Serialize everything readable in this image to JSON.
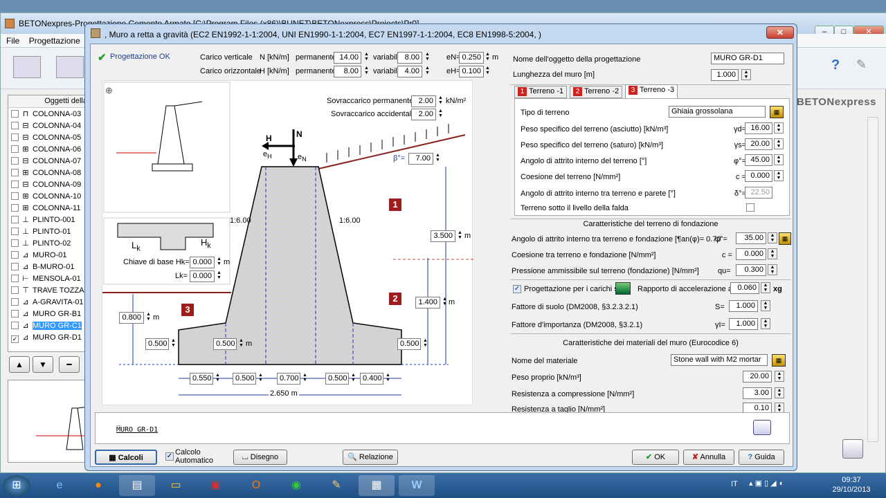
{
  "app": {
    "title": "BETONexpres-Progettazione Cemento Armato [C:\\Program Files (x86)\\BUNET\\BETONexpress\\Projects\\Pr0]",
    "menu": [
      "File",
      "Progettazione"
    ],
    "brand": "BETONexpress",
    "win_controls": [
      "–",
      "□",
      "✕"
    ]
  },
  "tree": {
    "header": "Oggetti della",
    "items": [
      {
        "label": "COLONNA-03",
        "checked": false
      },
      {
        "label": "COLONNA-04",
        "checked": false
      },
      {
        "label": "COLONNA-05",
        "checked": false
      },
      {
        "label": "COLONNA-06",
        "checked": false
      },
      {
        "label": "COLONNA-07",
        "checked": false
      },
      {
        "label": "COLONNA-08",
        "checked": false
      },
      {
        "label": "COLONNA-09",
        "checked": false
      },
      {
        "label": "COLONNA-10",
        "checked": false
      },
      {
        "label": "COLONNA-11",
        "checked": false
      },
      {
        "label": "PLINTO-001",
        "checked": false
      },
      {
        "label": "PLINTO-01",
        "checked": false
      },
      {
        "label": "PLINTO-02",
        "checked": false
      },
      {
        "label": "MURO-01",
        "checked": false
      },
      {
        "label": "B-MURO-01",
        "checked": false
      },
      {
        "label": "MENSOLA-01",
        "checked": false
      },
      {
        "label": "TRAVE TOZZA",
        "checked": false
      },
      {
        "label": "A-GRAVITA-01",
        "checked": false
      },
      {
        "label": "MURO GR-B1",
        "checked": false
      },
      {
        "label": "MURO GR-C1",
        "checked": false
      },
      {
        "label": "MURO GR-D1",
        "checked": true
      }
    ],
    "buttons": [
      "▲",
      "▼",
      "━"
    ]
  },
  "dialog": {
    "title": ", Muro a retta a gravità (EC2 EN1992-1-1:2004, UNI EN1990-1-1:2004, EC7 EN1997-1-1:2004, EC8 EN1998-5:2004, )",
    "close": "✕",
    "status": "Progettazione OK",
    "loads": {
      "vert_label": "Carico verticale",
      "vert_unit": "N [kN/m]",
      "horiz_label": "Carico orizzontale",
      "horiz_unit": "H [kN/m]",
      "perm": "permanente",
      "var": "variabile",
      "N_perm": "14.00",
      "N_var": "8.00",
      "eN_label": "eN=",
      "eN": "0.250",
      "H_perm": "8.00",
      "H_var": "4.00",
      "eH_label": "eH=",
      "eH": "0.100",
      "unit_m": "m"
    },
    "surcharge": {
      "perm_label": "Sovraccarico permanente",
      "perm": "2.00",
      "unit": "kN/m²",
      "acc_label": "Sovraccarico accidentale",
      "acc": "2.00",
      "beta_label": "β°=",
      "beta": "7.00"
    },
    "key": {
      "label_hk": "Chiave di base Hk=",
      "hk": "0.000",
      "label_lk": "Lk=",
      "lk": "0.000",
      "unit": "m",
      "Lk": "L",
      "Hk": "H",
      "sub": "k"
    },
    "drawing": {
      "H": "H",
      "N": "N",
      "eH": "e",
      "eHsub": "H",
      "eN": "e",
      "eNsub": "N",
      "slope_l": "1:6.00",
      "slope_r": "1:6.00",
      "h_total": "3.500",
      "h_lower": "1.400",
      "h_embed": "0.800",
      "base_l": "0.500",
      "base_m": "0.500",
      "base_r": "0.500",
      "w1": "0.550",
      "w2": "0.500",
      "w3": "0.700",
      "w4": "0.500",
      "w5": "0.400",
      "width_total": "2.650",
      "m": "m",
      "zones": [
        "1",
        "2",
        "3"
      ]
    },
    "right": {
      "name_label": "Nome dell'oggetto della progettazione",
      "name": "MURO GR-D1",
      "length_label": "Lunghezza del muro [m]",
      "length": "1.000",
      "tabs": [
        {
          "num": "1",
          "label": "Terreno -1"
        },
        {
          "num": "2",
          "label": "Terreno -2"
        },
        {
          "num": "3",
          "label": "Terreno -3"
        }
      ],
      "soil": {
        "type_label": "Tipo di terreno",
        "type": "Ghiaia grossolana",
        "gd_label": "Peso specifico del terreno (asciutto) [kN/m³]",
        "gd_sym": "γd=",
        "gd": "16.00",
        "gs_label": "Peso specifico del terreno (saturo) [kN/m³]",
        "gs_sym": "γs=",
        "gs": "20.00",
        "phi_label": "Angolo di attrito interno del terreno [°]",
        "phi_sym": "φ°=",
        "phi": "45.00",
        "c_label": "Coesione del terreno [N/mm²]",
        "c_sym": "c =",
        "c": "0.000",
        "delta_label": "Angolo di attrito interno tra terreno e parete [°]",
        "delta_sym": "δ°=",
        "delta": "22.50",
        "water_label": "Terreno sotto il livello della falda"
      },
      "foundation": {
        "head": "Caratteristiche del terreno di fondazione",
        "phi_label": "Angolo di attrito interno tra terreno e fondazione [¶an(φ)= 0.70",
        "phi_sym": "φ°=",
        "phi": "35.00",
        "c_label": "Coesione tra terreno e fondazione [N/mm²]",
        "c_sym": "c =",
        "c": "0.000",
        "q_label": "Pressione ammissibile sul terreno (fondazione) [N/mm²]",
        "q_sym": "qu=",
        "q": "0.300"
      },
      "seismic": {
        "check_label": "Progettazione per i carichi sism",
        "acc_label": "Rapporto di accelerazione a=",
        "acc": "0.060",
        "acc_unit": "xg",
        "s_label": "Fattore di suolo (DM2008, §3.2.3.2.1)",
        "s_sym": "S=",
        "s": "1.000",
        "g_label": "Fattore d'importanza (DM2008, §3.2.1)",
        "g_sym": "γI=",
        "g": "1.000"
      },
      "material": {
        "head": "Caratteristiche dei materiali del muro (Eurocodice 6)",
        "name_label": "Nome del materiale",
        "name": "Stone wall with M2 mortar",
        "w_label": "Peso proprio [kN/m³]",
        "w": "20.00",
        "fc_label": "Resistenza a compressione [N/mm²]",
        "fc": "3.00",
        "ft_label": "Resistenza a taglio [N/mm²]",
        "ft": "0.10"
      }
    },
    "memo": {
      "line1": "_",
      "line2": "MURO GR-D1"
    },
    "buttons": {
      "calc": "Calcoli",
      "auto1": "Calcolo",
      "auto2": "Automatico",
      "draw": "Disegno",
      "report": "Relazione",
      "ok": "OK",
      "cancel": "Annulla",
      "help": "Guida"
    }
  },
  "taskbar": {
    "lang": "IT",
    "time": "09:37",
    "date": "29/10/2013"
  },
  "colors": {
    "accent": "#a01c1c",
    "wall": "#d3d3d3",
    "dialog": "#c4d8ef"
  }
}
